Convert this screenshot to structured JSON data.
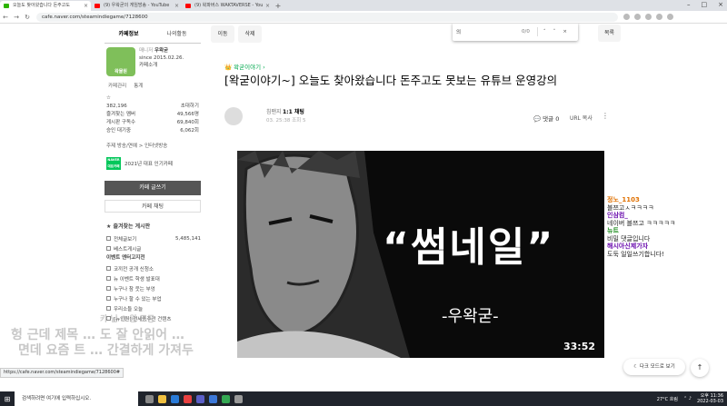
{
  "browser": {
    "tabs": [
      {
        "label": "오늘도 찾아왔습니다 돈주고도",
        "active": true,
        "color": "#2db400"
      },
      {
        "label": "(9) 우왁굳의 게임방송 - YouTube",
        "active": false,
        "color": "#ff0000"
      },
      {
        "label": "(9) 왁파버스 WAKTAVERSE - You",
        "active": false,
        "color": "#ff0000"
      }
    ],
    "new_tab": "+",
    "url": "cafe.naver.com/steamindiegame/7128600"
  },
  "toolbar": {
    "edit": "이동",
    "delete": "삭제",
    "list": "목록"
  },
  "findbar": {
    "query": "의",
    "count": "0/0",
    "prev": "˄",
    "next": "˅",
    "close": "×"
  },
  "sidebar": {
    "tabs": [
      "카페정보",
      "나의활동"
    ],
    "profile": {
      "image_text": "왁물원",
      "role": "매니저",
      "name": "우왁굳",
      "since": "since 2015.02.26.",
      "intro": "카페소개"
    },
    "manage": [
      "카페관리",
      "통계"
    ],
    "stats": [
      {
        "label": "☆",
        "value": ""
      },
      {
        "label": "382,196",
        "value": "초대하기"
      },
      {
        "label": "즐겨찾는 멤버",
        "value": "49,566명"
      },
      {
        "label": "게시판 구독수",
        "value": "69,840회"
      },
      {
        "label": "승인 대기중",
        "value": "6,062회"
      }
    ],
    "theme": "주제 방송/연예 > 인터넷방송",
    "naver_badge": "NAVER 대표카페",
    "year_badge": "2021년 대표 인기카페",
    "write_button": "카페 글쓰기",
    "chat_button": "카페 채팅",
    "fav_board": "즐겨찾는 게시판",
    "menu_items": [
      {
        "label": "전체글보기",
        "value": "5,485,141"
      },
      {
        "label": "베스트게시글",
        "value": ""
      }
    ],
    "menu_head": "이벤트 엔터고지전",
    "menu_items_2": [
      "코끼전 공개 신청소",
      "뉴 이벤트 학생 발표대",
      "누구나 참 웃는 부엉",
      "누구나 할 수 있는 부업",
      "우리소들 오늘",
      "[뉴인원] 전세종주전 건텐츠"
    ]
  },
  "article": {
    "category": "👑 왁굳이야기 ›",
    "title": "[왁굳이야기~] 오늘도 찾아왔습니다 돈주고도 못보는 유튜브 운영강의",
    "author_name": "침팬지",
    "author_level": "1:1 채팅",
    "meta": "03. 25:38  조회 5",
    "comments": "댓글 0",
    "url_copy": "URL 복사",
    "more": "⋮",
    "video": {
      "quote": "“썸네일”",
      "author": "-우왁굳-",
      "duration": "33:52"
    }
  },
  "chat_overlay": [
    {
      "text": "정노_1103",
      "color": "#e07000"
    },
    {
      "text": "블쯔고ㅅㅋㅋㅋㅋ",
      "color": "#222222"
    },
    {
      "text": "인삼컴_",
      "color": "#6a0dad"
    },
    {
      "text": "네이버 블쯔고 ㅋㅋㅋㅋㅋ",
      "color": "#222222"
    },
    {
      "text": "뉴트",
      "color": "#1e8c1e"
    },
    {
      "text": "비밀 댓글입니다",
      "color": "#222222"
    },
    {
      "text": "해시아신제가자",
      "color": "#6a0dad"
    },
    {
      "text": "도둑 일일쓰기합니다!",
      "color": "#222222"
    }
  ],
  "darkmode": "다크 모드로 보기",
  "top_button": "↑",
  "subtitles": [
    "카 님 0 원 조공",
    "헝 근데 제목 … 도 잘 안읽어 …",
    "면데 요즘 트 … 간결하게 가져두"
  ],
  "status_url": "https://cafe.naver.com/steamindiegame/7128600#",
  "taskbar": {
    "search_placeholder": "검색하려면 여기에 입력하십시오.",
    "weather": "27°C 흐림",
    "time": "오후 11:36",
    "date": "2022-03-03"
  },
  "colors": {
    "naver_green": "#03c75a",
    "cafe_green": "#03a94f"
  }
}
